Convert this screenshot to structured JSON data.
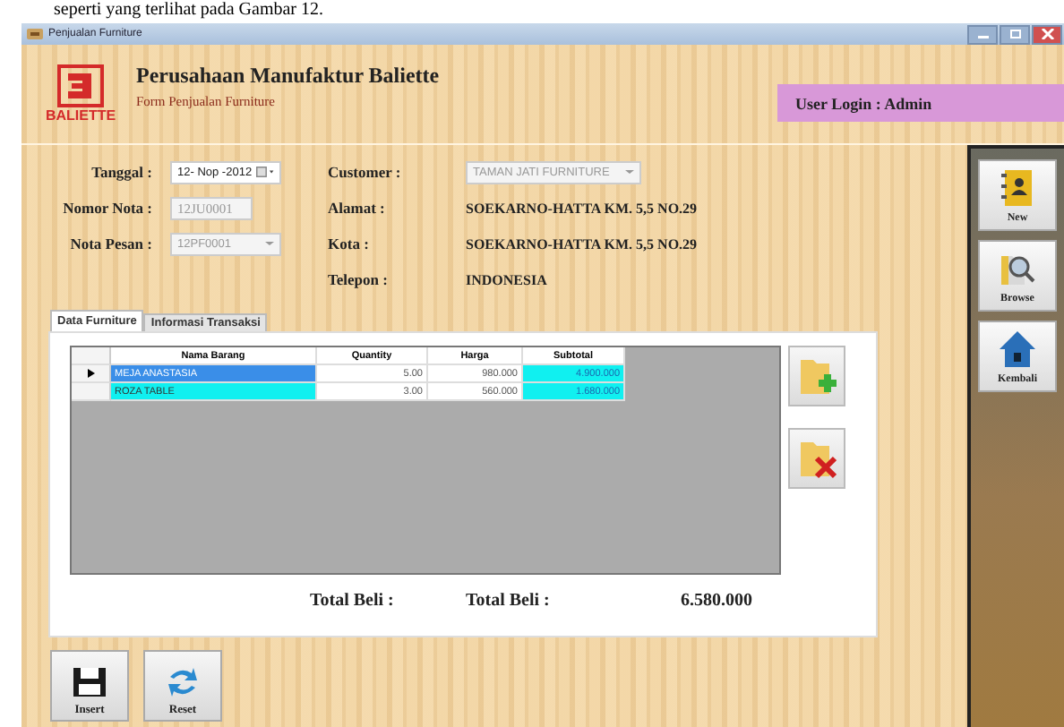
{
  "caption": "seperti yang terlihat pada Gambar 12.",
  "window": {
    "title": "Penjualan Furniture"
  },
  "header": {
    "logo": "BALIETTE",
    "company": "Perusahaan Manufaktur Baliette",
    "subtitle": "Form Penjualan Furniture",
    "user_login": "User Login : Admin"
  },
  "fields": [
    {
      "label": "Tanggal :",
      "value": "12- Nop -2012",
      "kind": "date",
      "disabled": false
    },
    {
      "label": "Nomor Nota :",
      "value": "12JU0001",
      "kind": "text",
      "disabled": true
    },
    {
      "label": "Nota Pesan :",
      "value": "12PF0001",
      "kind": "combo",
      "disabled": true
    }
  ],
  "info": [
    {
      "label": "Customer :",
      "value": "TAMAN JATI FURNITURE",
      "kind": "combo",
      "disabled": true
    },
    {
      "label": "Alamat :",
      "value": "SOEKARNO-HATTA KM. 5,5 NO.29",
      "kind": "text",
      "disabled": false
    },
    {
      "label": "Kota :",
      "value": "SOEKARNO-HATTA KM. 5,5 NO.29",
      "kind": "text",
      "disabled": false
    },
    {
      "label": "Telepon :",
      "value": "INDONESIA",
      "kind": "text",
      "disabled": false
    }
  ],
  "tabs": [
    {
      "label": "Data Furniture",
      "selected": true
    },
    {
      "label": "Informasi Transaksi",
      "selected": false
    }
  ],
  "table": {
    "columns": [
      "Nama Barang",
      "Quantity",
      "Harga",
      "Subtotal"
    ],
    "rows": [
      {
        "cells": [
          "MEJA ANASTASIA",
          "5.00",
          "980.000",
          "4.900.000"
        ],
        "selected": true
      },
      {
        "cells": [
          "ROZA TABLE",
          "3.00",
          "560.000",
          "1.680.000"
        ],
        "selected": false
      }
    ]
  },
  "totals": {
    "label_1": "Total Beli :",
    "label_2": "Total Beli :",
    "value": "6.580.000"
  },
  "side_buttons": [
    {
      "label": "New",
      "kind": "new"
    },
    {
      "label": "Browse",
      "kind": "browse"
    },
    {
      "label": "Kembali",
      "kind": "home"
    }
  ],
  "bottom_buttons": [
    {
      "label": "Insert",
      "kind": "save"
    },
    {
      "label": "Reset",
      "kind": "reset"
    }
  ]
}
